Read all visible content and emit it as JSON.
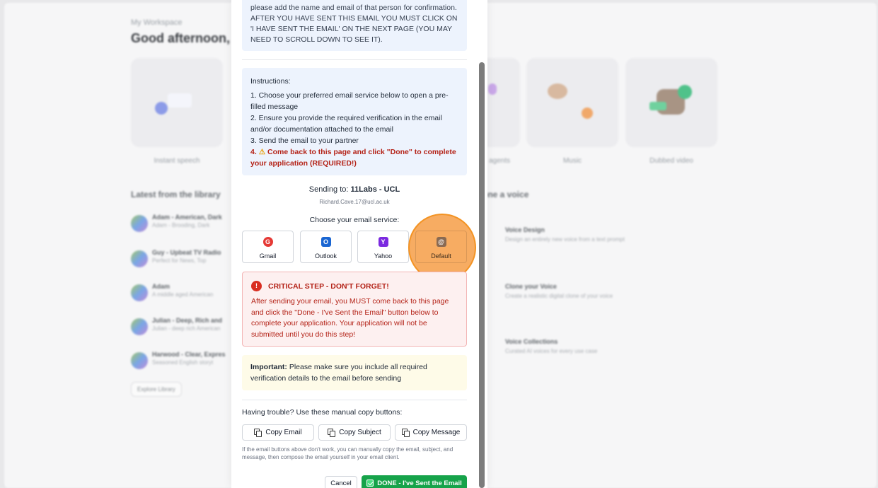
{
  "background": {
    "workspace_label": "My Workspace",
    "greeting": "Good afternoon,",
    "tiles": [
      {
        "label": "Instant speech"
      },
      {
        "label": ""
      },
      {
        "label": ""
      },
      {
        "label": "agents"
      },
      {
        "label": "Music"
      },
      {
        "label": "Dubbed video"
      }
    ],
    "library_title": "Latest from the library",
    "library_items": [
      {
        "name": "Adam - American, Dark",
        "desc": "Adam - Brooding, Dark"
      },
      {
        "name": "Guy - Upbeat TV Radio",
        "desc": "Perfect for News, Top"
      },
      {
        "name": "Adam",
        "desc": "A middle aged American"
      },
      {
        "name": "Julian - Deep, Rich and",
        "desc": "Julian - deep rich American"
      },
      {
        "name": "Harwood - Clear, Expres",
        "desc": "Seasoned English storyt"
      }
    ],
    "explore_label": "Explore Library",
    "voice_title": "one a voice",
    "voice_items": [
      {
        "name": "Voice Design",
        "desc": "Design an entirely new voice from a text prompt"
      },
      {
        "name": "Clone your Voice",
        "desc": "Create a realistic digital clone of your voice"
      },
      {
        "name": "Voice Collections",
        "desc": "Curated AI voices for every use case"
      }
    ]
  },
  "modal": {
    "top_warning": "please add the name and email of that person for confirmation. AFTER YOU HAVE SENT THIS EMAIL YOU MUST CLICK ON 'I HAVE SENT THE EMAIL' ON THE NEXT PAGE (YOU MAY NEED TO SCROLL DOWN TO SEE IT).",
    "instructions": {
      "heading": "Instructions:",
      "step1": "1. Choose your preferred email service below to open a pre-filled message",
      "step2": "2. Ensure you provide the required verification in the email and/or documentation attached to the email",
      "step3": "3. Send the email to your partner",
      "step4_prefix": "4.",
      "step4_text": "Come back to this page and click \"Done\" to complete your application (REQUIRED!)"
    },
    "sending_to_label": "Sending to:",
    "sending_to_name": "11Labs - UCL",
    "sending_to_email": "Richard.Cave.17@ucl.ac.uk",
    "choose_label": "Choose your email service:",
    "services": [
      {
        "label": "Gmail",
        "glyph": "G",
        "icon": "gmail-icon",
        "color": "#e53935"
      },
      {
        "label": "Outlook",
        "glyph": "O",
        "icon": "outlook-icon",
        "color": "#1a66d2"
      },
      {
        "label": "Yahoo",
        "glyph": "Y",
        "icon": "yahoo-icon",
        "color": "#7b2ae0"
      },
      {
        "label": "Default",
        "glyph": "@",
        "icon": "at-sign-icon",
        "color": "#8a6a52"
      }
    ],
    "critical": {
      "icon_glyph": "!",
      "title": "CRITICAL STEP - DON'T FORGET!",
      "body": "After sending your email, you MUST come back to this page and click the \"Done - I've Sent the Email\" button below to complete your application. Your application will not be submitted until you do this step!"
    },
    "important": {
      "label": "Important:",
      "text": "Please make sure you include all required verification details to the email before sending"
    },
    "trouble_label": "Having trouble? Use these manual copy buttons:",
    "copy_buttons": {
      "email": "Copy Email",
      "subject": "Copy Subject",
      "message": "Copy Message"
    },
    "copy_note": "If the email buttons above don't work, you can manually copy the email, subject, and message, then compose the email yourself in your email client.",
    "cancel_label": "Cancel",
    "done_label": "DONE - I've Sent the Email"
  },
  "colors": {
    "done_green": "#16a34a",
    "critical_red": "#b42318",
    "highlight_orange": "#f39323"
  }
}
